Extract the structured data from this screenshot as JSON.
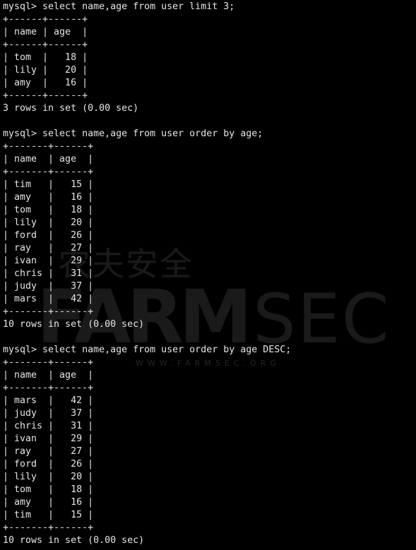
{
  "terminal": {
    "lines": [
      "mysql> select name,age from user limit 3;",
      "+------+------+",
      "| name | age  |",
      "+------+------+",
      "| tom  |   18 |",
      "| lily |   20 |",
      "| amy  |   16 |",
      "+------+------+",
      "3 rows in set (0.00 sec)",
      "",
      "mysql> select name,age from user order by age;",
      "+-------+------+",
      "| name  | age  |",
      "+-------+------+",
      "| tim   |   15 |",
      "| amy   |   16 |",
      "| tom   |   18 |",
      "| lily  |   20 |",
      "| ford  |   26 |",
      "| ray   |   27 |",
      "| ivan  |   29 |",
      "| chris |   31 |",
      "| judy  |   37 |",
      "| mars  |   42 |",
      "+-------+------+",
      "10 rows in set (0.00 sec)",
      "",
      "mysql> select name,age from user order by age DESC;",
      "+-------+------+",
      "| name  | age  |",
      "+-------+------+",
      "| mars  |   42 |",
      "| judy  |   37 |",
      "| chris |   31 |",
      "| ivan  |   29 |",
      "| ray   |   27 |",
      "| ford  |   26 |",
      "| lily  |   20 |",
      "| tom   |   18 |",
      "| amy   |   16 |",
      "| tim   |   15 |",
      "+-------+------+",
      "10 rows in set (0.00 sec)"
    ]
  },
  "watermark": {
    "chinese": "农夫安全",
    "brand_left": "FARM",
    "brand_right": "SEC",
    "url": "WWW.FARMSEC.ORG"
  },
  "colors": {
    "background": "#000000",
    "text": "#e6e6e6"
  }
}
